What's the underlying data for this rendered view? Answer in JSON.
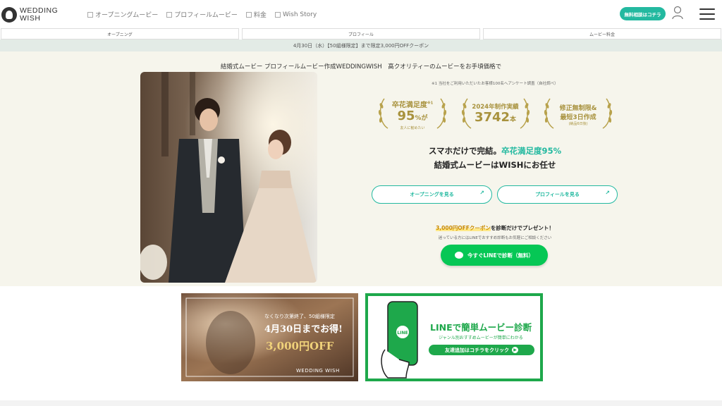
{
  "header": {
    "logo_line1": "WEDDING",
    "logo_line2": "WISH",
    "nav": [
      {
        "label": "オープニングムービー"
      },
      {
        "label": "プロフィールムービー"
      },
      {
        "label": "料金"
      },
      {
        "label": "Wish Story"
      }
    ],
    "cta_label": "無料相談はコチラ"
  },
  "tabs": [
    {
      "label": "オープニング"
    },
    {
      "label": "プロフィール"
    },
    {
      "label": "ムービー料金"
    }
  ],
  "coupon_strip": "4月30日（水）【50組様限定】まで限定3,000円OFFクーポン",
  "hero": {
    "title": "結婚式ムービー プロフィールムービー作成WEDDINGWISH　高クオリティーのムービーをお手頃価格で",
    "note": "※1 当社をご利用いただいたお客様100名へアンケート調査（自社調べ）",
    "badges": [
      {
        "line1": "卒花満足度",
        "sup": "※1",
        "main": "95",
        "unit": "%が",
        "sub": "友人に勧めたい"
      },
      {
        "line1": "2024年制作実績",
        "sup": "",
        "main": "3742",
        "unit": "本",
        "sub": ""
      },
      {
        "line1": "修正無制限&",
        "sup": "",
        "main": "最短3日作成",
        "unit": "",
        "sub": "(納品6日後)"
      }
    ],
    "tagline1_a": "スマホだけで完結。",
    "tagline1_b": "卒花満足度95%",
    "tagline2": "結婚式ムービーはWISHにお任せ",
    "btn_opening": "オープニングを見る",
    "btn_profile": "プロフィールを見る",
    "promo_hl": "3,000円OFFクーポン",
    "promo_rest": "を診断だけでプレゼント！",
    "promo_sub": "迷っている方にはLINEでおすすめ診断もお気軽にご相談ください",
    "line_btn": "今すぐLINEで診断（無料）"
  },
  "banner_left": {
    "lead": "なくなり次第終了、50組様限定",
    "headline": "4月30日までお得!",
    "amount": "3,000円OFF",
    "brand": "WEDDING WISH"
  },
  "banner_right": {
    "title": "LINEで簡単ムービー診断",
    "sub": "ジャンル別おすすめムービーが簡単にわかる",
    "button": "友達追加はコチラをクリック",
    "phone_label": "LINE"
  }
}
